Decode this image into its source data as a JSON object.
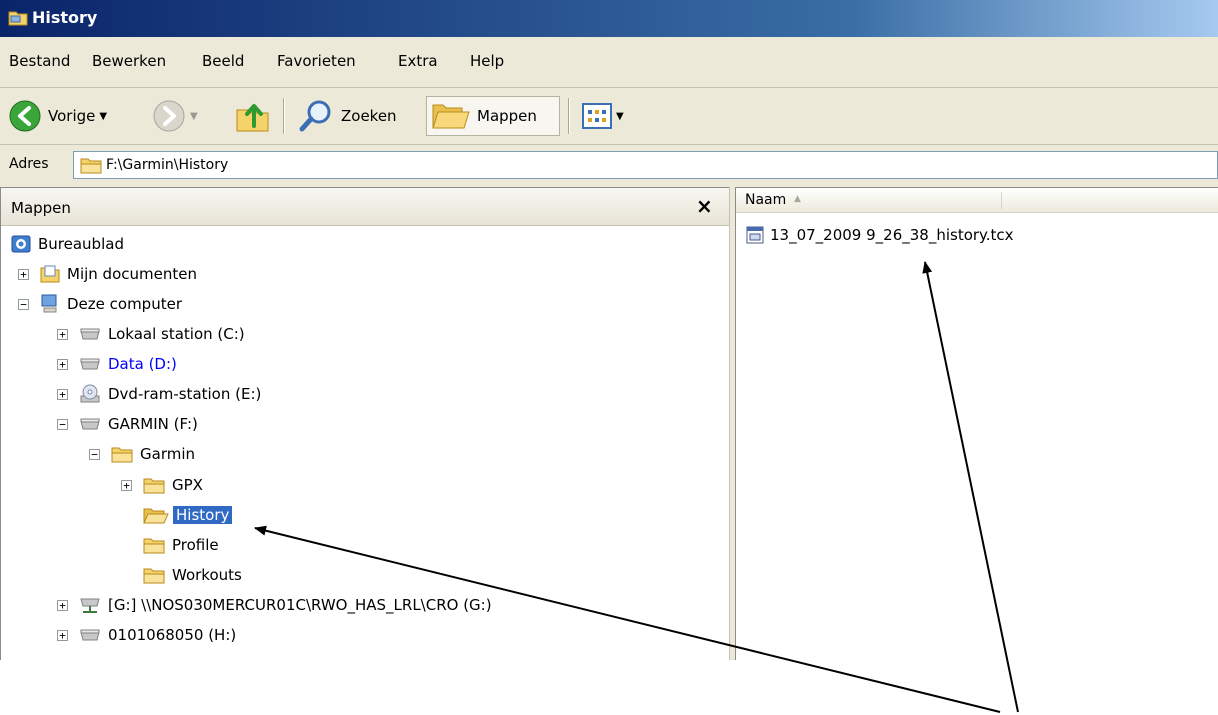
{
  "window": {
    "title": "History"
  },
  "menu": [
    "Bestand",
    "Bewerken",
    "Beeld",
    "Favorieten",
    "Extra",
    "Help"
  ],
  "toolbar": {
    "back": "Vorige",
    "search": "Zoeken",
    "folders": "Mappen"
  },
  "address": {
    "label": "Adres",
    "value": "F:\\Garmin\\History"
  },
  "folders_pane": {
    "title": "Mappen",
    "close": "×",
    "tree": [
      {
        "label": "Bureaublad"
      },
      {
        "label": "Mijn documenten",
        "expander": "+"
      },
      {
        "label": "Deze computer",
        "expander": "−"
      },
      {
        "label": "Lokaal station (C:)",
        "expander": "+"
      },
      {
        "label": "Data (D:)",
        "expander": "+"
      },
      {
        "label": "Dvd-ram-station (E:)",
        "expander": "+"
      },
      {
        "label": "GARMIN (F:)",
        "expander": "−"
      },
      {
        "label": "Garmin",
        "expander": "−"
      },
      {
        "label": "GPX",
        "expander": "+"
      },
      {
        "label": "History",
        "selected": true
      },
      {
        "label": "Profile"
      },
      {
        "label": "Workouts"
      },
      {
        "label": "[G:] \\\\NOS030MERCUR01C\\RWO_HAS_LRL\\CRO (G:)",
        "expander": "+"
      },
      {
        "label": "0101068050 (H:)",
        "expander": "+"
      }
    ]
  },
  "file_list": {
    "column_header": "Naam",
    "files": [
      "13_07_2009 9_26_38_history.tcx"
    ]
  },
  "colors": {
    "title_bar": "#0a246a",
    "selection": "#316ac5",
    "annotation_arrow": "#000000"
  }
}
